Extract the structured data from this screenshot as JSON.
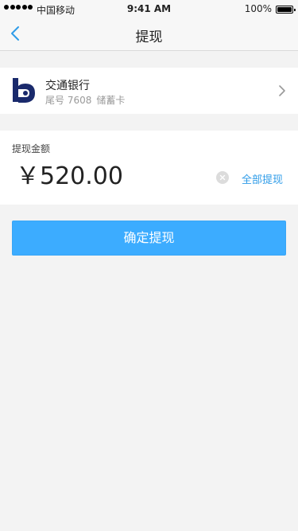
{
  "status_bar": {
    "carrier": "中国移动",
    "time": "9:41 AM",
    "battery": "100%"
  },
  "nav": {
    "title": "提现",
    "back_icon": "chevron-left-icon",
    "accent": "#2f9ce8"
  },
  "bank": {
    "name": "交通银行",
    "tail_number": "尾号 7608",
    "card_type": "储蓄卡",
    "logo_color": "#1a2a6c"
  },
  "amount": {
    "label": "提现金额",
    "value": "￥520.00",
    "withdraw_all": "全部提现"
  },
  "confirm": {
    "label": "确定提现",
    "color": "#3cacff"
  }
}
